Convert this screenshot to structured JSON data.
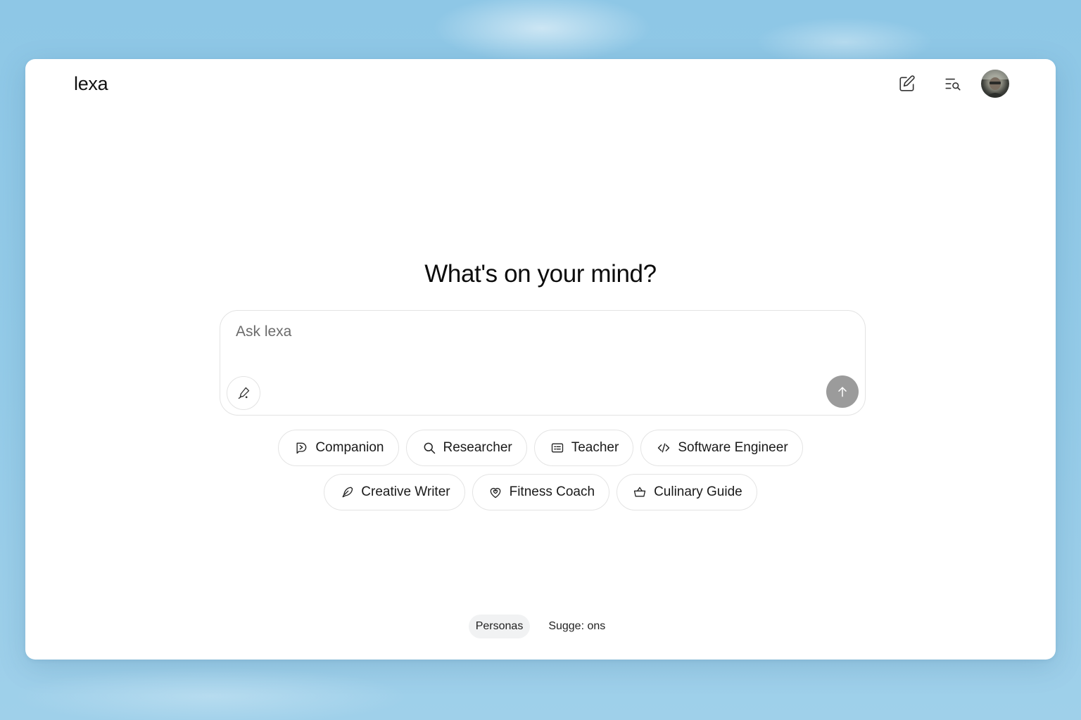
{
  "app": {
    "name": "lexa"
  },
  "header": {
    "actions": [
      {
        "name": "new-chat",
        "icon": "edit-icon"
      },
      {
        "name": "search-chats",
        "icon": "list-search-icon"
      }
    ],
    "avatar": {
      "icon": "user-avatar"
    }
  },
  "main": {
    "headline": "What's on your mind?",
    "composer": {
      "placeholder": "Ask lexa",
      "tool_icon": "pen-icon",
      "send_icon": "arrow-up-icon",
      "send_color": "#9b9b9b"
    },
    "personas_row1": [
      {
        "label": "Companion",
        "icon": "companion-icon"
      },
      {
        "label": "Researcher",
        "icon": "search-icon"
      },
      {
        "label": "Teacher",
        "icon": "board-icon"
      },
      {
        "label": "Software Engineer",
        "icon": "code-icon"
      }
    ],
    "personas_row2": [
      {
        "label": "Creative Writer",
        "icon": "feather-icon"
      },
      {
        "label": "Fitness Coach",
        "icon": "heart-shield-icon"
      },
      {
        "label": "Culinary Guide",
        "icon": "basket-icon"
      }
    ]
  },
  "footer": {
    "tabs": [
      {
        "label": "Personas",
        "active": true
      },
      {
        "label": "Sugge: ons",
        "active": false
      }
    ]
  },
  "colors": {
    "background": "#94cbe8",
    "window": "#ffffff",
    "chip_border": "#e4e4e4",
    "active_tab": "#f1f2f3"
  }
}
